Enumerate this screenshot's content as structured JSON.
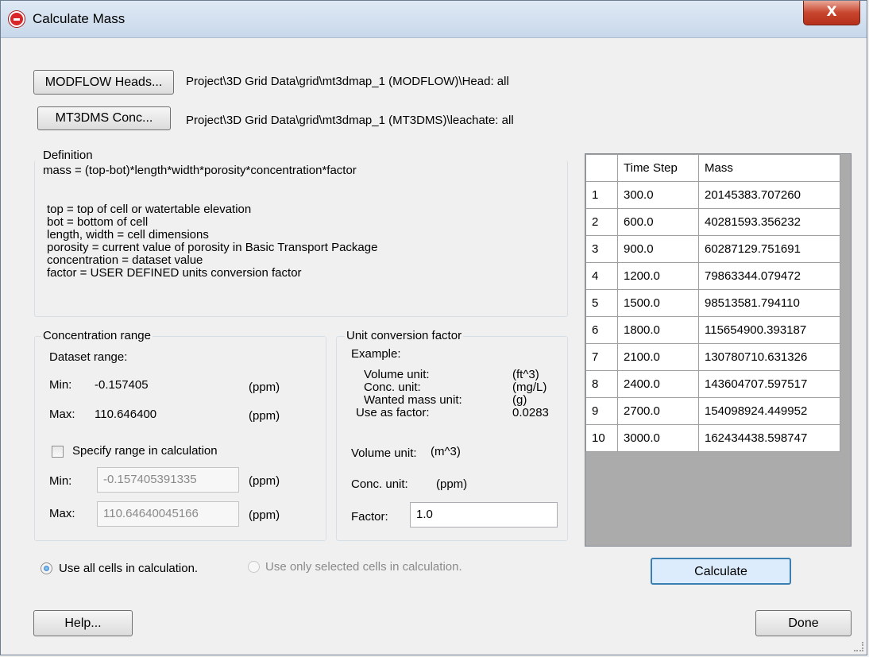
{
  "window": {
    "title": "Calculate Mass",
    "close_symbol": "X"
  },
  "datasets": {
    "heads_button": "MODFLOW Heads...",
    "heads_path": "Project\\3D Grid Data\\grid\\mt3dmap_1 (MODFLOW)\\Head: all",
    "conc_button": "MT3DMS Conc...",
    "conc_path": "Project\\3D Grid Data\\grid\\mt3dmap_1 (MT3DMS)\\leachate: all"
  },
  "definition": {
    "label": "Definition",
    "formula": "mass = (top-bot)*length*width*porosity*concentration*factor",
    "lines": [
      "top = top of cell or watertable elevation",
      "bot = bottom of cell",
      "length, width = cell dimensions",
      "porosity = current value of porosity in Basic Transport Package",
      "concentration = dataset value",
      "factor = USER DEFINED units conversion factor"
    ]
  },
  "concentration_range": {
    "label": "Concentration range",
    "dataset_range_label": "Dataset range:",
    "min_label": "Min:",
    "min_value": "-0.157405",
    "max_label": "Max:",
    "max_value": "110.646400",
    "unit": "(ppm)",
    "specify_label": "Specify range in calculation",
    "specify_checked": false,
    "min_input": "-0.157405391335",
    "max_input": "110.64640045166"
  },
  "unit_conversion": {
    "label": "Unit conversion factor",
    "example_label": "Example:",
    "example_rows": [
      {
        "label": "Volume unit:",
        "value": "(ft^3)"
      },
      {
        "label": "Conc. unit:",
        "value": "(mg/L)"
      },
      {
        "label": "Wanted mass unit:",
        "value": "(g)"
      },
      {
        "label": "Use as factor:",
        "value": "0.0283"
      }
    ],
    "volume_label": "Volume unit:",
    "volume_value": "(m^3)",
    "conc_label": "Conc. unit:",
    "conc_value": "(ppm)",
    "factor_label": "Factor:",
    "factor_value": "1.0"
  },
  "cells_option": {
    "all_label": "Use all cells in calculation.",
    "selected_label": "Use only selected cells in calculation.",
    "selected": "all"
  },
  "results": {
    "headers": [
      "",
      "Time Step",
      "Mass"
    ],
    "rows": [
      [
        "1",
        "300.0",
        "20145383.707260"
      ],
      [
        "2",
        "600.0",
        "40281593.356232"
      ],
      [
        "3",
        "900.0",
        "60287129.751691"
      ],
      [
        "4",
        "1200.0",
        "79863344.079472"
      ],
      [
        "5",
        "1500.0",
        "98513581.794110"
      ],
      [
        "6",
        "1800.0",
        "115654900.393187"
      ],
      [
        "7",
        "2100.0",
        "130780710.631326"
      ],
      [
        "8",
        "2400.0",
        "143604707.597517"
      ],
      [
        "9",
        "2700.0",
        "154098924.449952"
      ],
      [
        "10",
        "3000.0",
        "162434438.598747"
      ]
    ]
  },
  "buttons": {
    "calculate": "Calculate",
    "help": "Help...",
    "done": "Done"
  },
  "colors": {
    "calculate_border": "#3c7fb1",
    "calculate_bg": "#dcecfc"
  }
}
